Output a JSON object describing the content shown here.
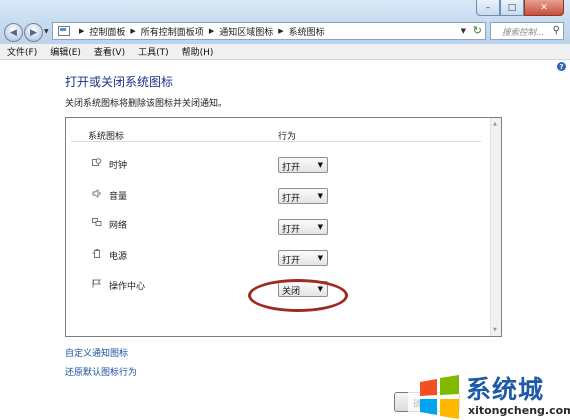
{
  "window": {
    "breadcrumbs": [
      "控制面板",
      "所有控制面板项",
      "通知区域图标",
      "系统图标"
    ],
    "search_placeholder": "搜索控制..."
  },
  "menu": [
    "文件(F)",
    "编辑(E)",
    "查看(V)",
    "工具(T)",
    "帮助(H)"
  ],
  "page": {
    "title": "打开或关闭系统图标",
    "description": "关闭系统图标将删除该图标并关闭通知。"
  },
  "table": {
    "col_icon": "系统图标",
    "col_behavior": "行为",
    "rows": [
      {
        "label": "时钟",
        "value": "打开",
        "icon": "clock-icon"
      },
      {
        "label": "音量",
        "value": "打开",
        "icon": "speaker-icon"
      },
      {
        "label": "网络",
        "value": "打开",
        "icon": "network-icon"
      },
      {
        "label": "电源",
        "value": "打开",
        "icon": "power-icon"
      },
      {
        "label": "操作中心",
        "value": "关闭",
        "icon": "flag-icon"
      }
    ]
  },
  "links": {
    "customize": "自定义通知图标",
    "restore": "还原默认图标行为"
  },
  "buttons": {
    "ok": "确"
  },
  "watermark": {
    "brand": "系统城",
    "url": "xitongcheng.com"
  },
  "colors": {
    "title_blue": "#1e3287",
    "link_blue": "#1a4fa3",
    "highlight_ring": "#a02a22"
  }
}
